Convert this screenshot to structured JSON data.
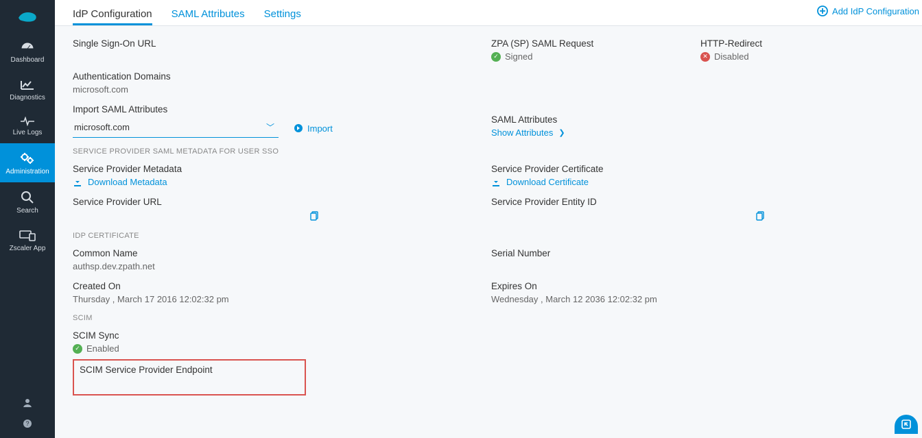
{
  "sidebar": {
    "items": [
      {
        "label": "Dashboard"
      },
      {
        "label": "Diagnostics"
      },
      {
        "label": "Live Logs"
      },
      {
        "label": "Administration"
      },
      {
        "label": "Search"
      },
      {
        "label": "Zscaler App"
      }
    ]
  },
  "tabs": {
    "t0": "IdP Configuration",
    "t1": "SAML Attributes",
    "t2": "Settings"
  },
  "header": {
    "add_label": "Add IdP Configuration"
  },
  "sso": {
    "sso_url_label": "Single Sign-On URL",
    "saml_request_label": "ZPA (SP) SAML Request",
    "saml_request_status": "Signed",
    "http_redirect_label": "HTTP-Redirect",
    "http_redirect_status": "Disabled"
  },
  "auth_domains": {
    "label": "Authentication Domains",
    "value": "microsoft.com"
  },
  "import_saml": {
    "label": "Import SAML Attributes",
    "selected": "microsoft.com",
    "import_btn": "Import"
  },
  "saml_attributes": {
    "label": "SAML Attributes",
    "show_link": "Show Attributes"
  },
  "sp_meta_section": "SERVICE PROVIDER SAML METADATA FOR USER SSO",
  "sp": {
    "metadata_label": "Service Provider Metadata",
    "download_metadata": "Download Metadata",
    "cert_label": "Service Provider Certificate",
    "download_cert": "Download Certificate",
    "url_label": "Service Provider URL",
    "entity_label": "Service Provider Entity ID"
  },
  "idp_cert_section": "IdP CERTIFICATE",
  "idp_cert": {
    "cn_label": "Common Name",
    "cn_value": "authsp.dev.zpath.net",
    "serial_label": "Serial Number",
    "created_label": "Created On",
    "created_value": "Thursday , March 17 2016 12:02:32 pm",
    "expires_label": "Expires On",
    "expires_value": "Wednesday , March 12 2036 12:02:32 pm"
  },
  "scim_section": "SCIM",
  "scim": {
    "sync_label": "SCIM Sync",
    "sync_status": "Enabled",
    "endpoint_label": "SCIM Service Provider Endpoint"
  }
}
